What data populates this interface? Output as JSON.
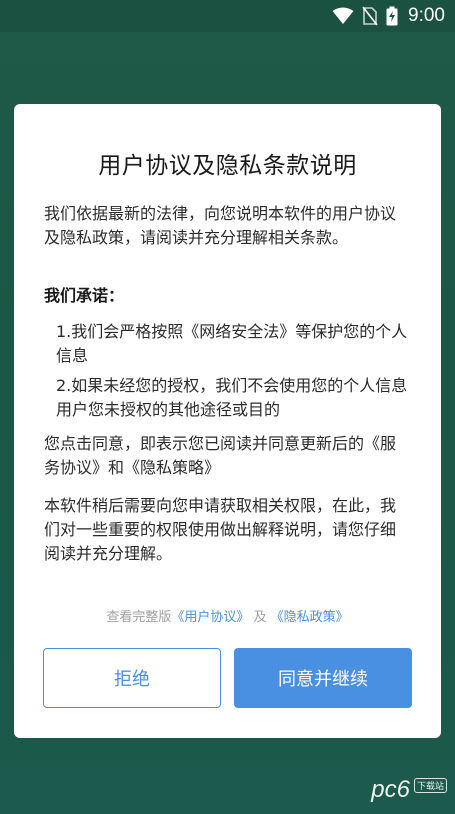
{
  "status_bar": {
    "time": "9:00",
    "icons": [
      "wifi-icon",
      "no-sim-icon",
      "battery-charging-icon"
    ]
  },
  "dialog": {
    "title": "用户协议及隐私条款说明",
    "intro": "我们依据最新的法律，向您说明本软件的用户协议及隐私政策，请阅读并充分理解相关条款。",
    "promise_heading": "我们承诺：",
    "promises": [
      "1.我们会严格按照《网络安全法》等保护您的个人信息",
      "2.如果未经您的授权，我们不会使用您的个人信息用户您未授权的其他途径或目的"
    ],
    "consent": "您点击同意，即表示您已阅读并同意更新后的《服务协议》和《隐私策略》",
    "permission": "本软件稍后需要向您申请获取相关权限，在此，我们对一些重要的权限使用做出解释说明，请您仔细阅读并充分理解。",
    "links": {
      "prefix": "查看完整版",
      "user_agreement": "《用户协议》",
      "conjunction": "及",
      "privacy_policy": "《隐私政策》"
    },
    "reject_label": "拒绝",
    "accept_label": "同意并继续"
  },
  "watermark": {
    "text": "pc6",
    "sub": "下载站"
  },
  "colors": {
    "background": "#1c5646",
    "accent": "#4a90e2",
    "dialog": "#ffffff"
  }
}
